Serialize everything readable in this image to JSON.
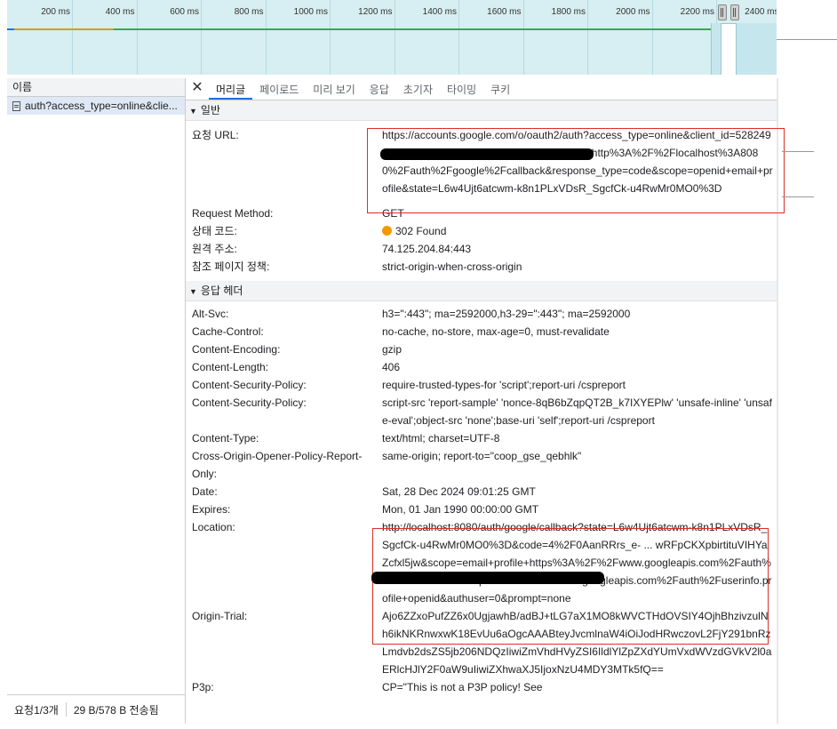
{
  "timeline": {
    "ticks": [
      "200 ms",
      "400 ms",
      "600 ms",
      "800 ms",
      "1000 ms",
      "1200 ms",
      "1400 ms",
      "1600 ms",
      "1800 ms",
      "2000 ms",
      "2200 ms",
      "2400 ms"
    ]
  },
  "left_panel": {
    "header": "이름",
    "request_name": "auth?access_type=online&clie...",
    "footer_requests": "요청1/3개",
    "footer_transferred": "29 B/578 B 전송됨"
  },
  "tabs": [
    "머리글",
    "페이로드",
    "미리 보기",
    "응답",
    "초기자",
    "타이밍",
    "쿠키"
  ],
  "active_tab": "머리글",
  "general": {
    "title": "일반",
    "rows": [
      {
        "k": "요청 URL:",
        "v": "https://accounts.google.com/o/oauth2/auth?access_type=online&client_id=528249 ... pps.googleusercontent.com&redirect_uri=http%3A%2F%2Flocalhost%3A8080%2Fauth%2Fgoogle%2Fcallback&response_type=code&scope=openid+email+profile&state=L6w4Ujt6atcwm-k8n1PLxVDsR_SgcfCk-u4RwMr0MO0%3D"
      },
      {
        "k": "Request Method:",
        "v": "GET"
      },
      {
        "k": "상태 코드:",
        "v": "302 Found"
      },
      {
        "k": "원격 주소:",
        "v": "74.125.204.84:443"
      },
      {
        "k": "참조 페이지 정책:",
        "v": "strict-origin-when-cross-origin"
      }
    ]
  },
  "response_headers": {
    "title": "응답 헤더",
    "rows": [
      {
        "k": "Alt-Svc:",
        "v": "h3=\":443\"; ma=2592000,h3-29=\":443\"; ma=2592000"
      },
      {
        "k": "Cache-Control:",
        "v": "no-cache, no-store, max-age=0, must-revalidate"
      },
      {
        "k": "Content-Encoding:",
        "v": "gzip"
      },
      {
        "k": "Content-Length:",
        "v": "406"
      },
      {
        "k": "Content-Security-Policy:",
        "v": "require-trusted-types-for 'script';report-uri /cspreport"
      },
      {
        "k": "Content-Security-Policy:",
        "v": "script-src 'report-sample' 'nonce-8qB6bZqpQT2B_k7IXYEPlw' 'unsafe-inline' 'unsafe-eval';object-src 'none';base-uri 'self';report-uri /cspreport"
      },
      {
        "k": "Content-Type:",
        "v": "text/html; charset=UTF-8"
      },
      {
        "k": "Cross-Origin-Opener-Policy-Report-Only:",
        "v": "same-origin; report-to=\"coop_gse_qebhlk\""
      },
      {
        "k": "Date:",
        "v": "Sat, 28 Dec 2024 09:01:25 GMT"
      },
      {
        "k": "Expires:",
        "v": "Mon, 01 Jan 1990 00:00:00 GMT"
      },
      {
        "k": "Location:",
        "v": "http://localhost:8080/auth/google/callback?state=L6w4Ujt6atcwm-k8n1PLxVDsR_SgcfCk-u4RwMr0MO0%3D&code=4%2F0AanRRrs_e- ... wRFpCKXpbirtituVIHYaZcfxl5jw&scope=email+profile+https%3A%2F%2Fwww.googleapis.com%2Fauth%2Fuserinfo.email+https%3A%2F%2Fwww.googleapis.com%2Fauth%2Fuserinfo.profile+openid&authuser=0&prompt=none"
      },
      {
        "k": "Origin-Trial:",
        "v": "Ajo6ZZxoPufZZ6x0UgjawhB/adBJ+tLG7aX1MO8kWVCTHdOVSIY4OjhBhzivzulNh6ikNKRnwxwK18EvUu6aOgcAAABteyJvcmlnaW4iOiJodHRwczovL2FjY291bnRzLmdvb2dsZS5jb206NDQzIiwiZmVhdHVyZSI6IldlYlZpZXdYUmVxdWVzdGVkV2l0aERlcHJlY2F0aW9uIiwiZXhwaXJ5IjoxNzU4MDY3MTk5fQ=="
      },
      {
        "k": "P3p:",
        "v": "CP=\"This is not a P3P policy! See"
      }
    ]
  },
  "colors": {
    "status_dot": "#f29900",
    "highlight_box": "#d93025",
    "tab_accent": "#1a73e8"
  }
}
